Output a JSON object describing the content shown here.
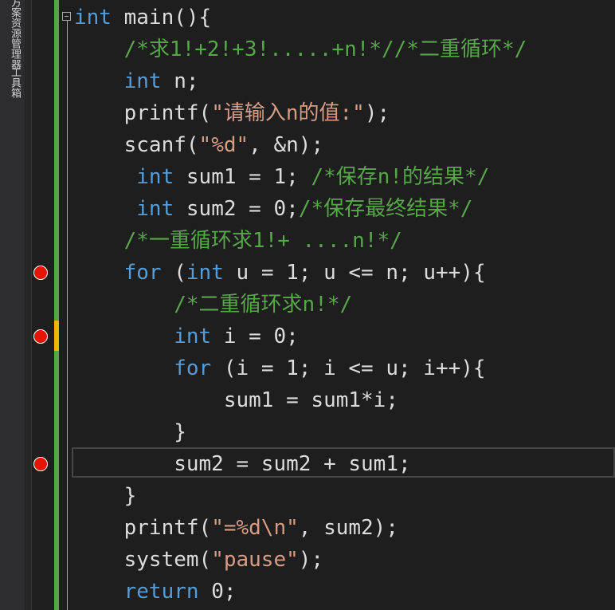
{
  "sidebar": {
    "solution_explorer_label": "方案资源管理器",
    "toolbox_label": "工具箱"
  },
  "editor": {
    "colors": {
      "background": "#1e1e1e",
      "keyword": "#569cd6",
      "comment": "#57a64a",
      "string": "#d69d85",
      "text": "#dcdcdc",
      "breakpoint": "#e51400",
      "change_saved": "#57a64a",
      "change_unsaved": "#efb700"
    },
    "lines": [
      [
        {
          "t": "int",
          "c": "kw"
        },
        {
          "t": " main(){",
          "c": ""
        }
      ],
      [
        {
          "t": "    /*求1!+2!+3!.....+n!*//*二重循环*/",
          "c": "cm"
        }
      ],
      [
        {
          "t": "    ",
          "c": ""
        },
        {
          "t": "int",
          "c": "kw"
        },
        {
          "t": " n;",
          "c": ""
        }
      ],
      [
        {
          "t": "    printf(",
          "c": ""
        },
        {
          "t": "\"请输入n的值:\"",
          "c": "str"
        },
        {
          "t": ");",
          "c": ""
        }
      ],
      [
        {
          "t": "    scanf(",
          "c": ""
        },
        {
          "t": "\"%d\"",
          "c": "str"
        },
        {
          "t": ", &n);",
          "c": ""
        }
      ],
      [
        {
          "t": "     ",
          "c": ""
        },
        {
          "t": "int",
          "c": "kw"
        },
        {
          "t": " sum1 = 1; ",
          "c": ""
        },
        {
          "t": "/*保存n!的结果*/",
          "c": "cm"
        }
      ],
      [
        {
          "t": "     ",
          "c": ""
        },
        {
          "t": "int",
          "c": "kw"
        },
        {
          "t": " sum2 = 0;",
          "c": ""
        },
        {
          "t": "/*保存最终结果*/",
          "c": "cm"
        }
      ],
      [
        {
          "t": "    /*一重循环求1!+ ....n!*/",
          "c": "cm"
        }
      ],
      [
        {
          "t": "    ",
          "c": ""
        },
        {
          "t": "for",
          "c": "kw"
        },
        {
          "t": " (",
          "c": ""
        },
        {
          "t": "int",
          "c": "kw"
        },
        {
          "t": " u = 1; u <= n; u++){",
          "c": ""
        }
      ],
      [
        {
          "t": "        /*二重循环求n!*/",
          "c": "cm"
        }
      ],
      [
        {
          "t": "        ",
          "c": ""
        },
        {
          "t": "int",
          "c": "kw"
        },
        {
          "t": " i = 0;",
          "c": ""
        }
      ],
      [
        {
          "t": "        ",
          "c": ""
        },
        {
          "t": "for",
          "c": "kw"
        },
        {
          "t": " (i = 1; i <= u; i++){",
          "c": ""
        }
      ],
      [
        {
          "t": "            sum1 = sum1*i;",
          "c": ""
        }
      ],
      [
        {
          "t": "        }",
          "c": ""
        }
      ],
      [
        {
          "t": "        sum2 = sum2 + sum1;",
          "c": ""
        }
      ],
      [
        {
          "t": "    }",
          "c": ""
        }
      ],
      [
        {
          "t": "    printf(",
          "c": ""
        },
        {
          "t": "\"=%d\\n\"",
          "c": "str"
        },
        {
          "t": ", sum2);",
          "c": ""
        }
      ],
      [
        {
          "t": "    system(",
          "c": ""
        },
        {
          "t": "\"pause\"",
          "c": "str"
        },
        {
          "t": ");",
          "c": ""
        }
      ],
      [
        {
          "t": "    ",
          "c": ""
        },
        {
          "t": "return",
          "c": "kw"
        },
        {
          "t": " 0;",
          "c": ""
        }
      ]
    ],
    "breakpoints_on_lines": [
      9,
      11,
      15
    ],
    "unsaved_change_lines": [
      11
    ],
    "current_line": 15
  }
}
